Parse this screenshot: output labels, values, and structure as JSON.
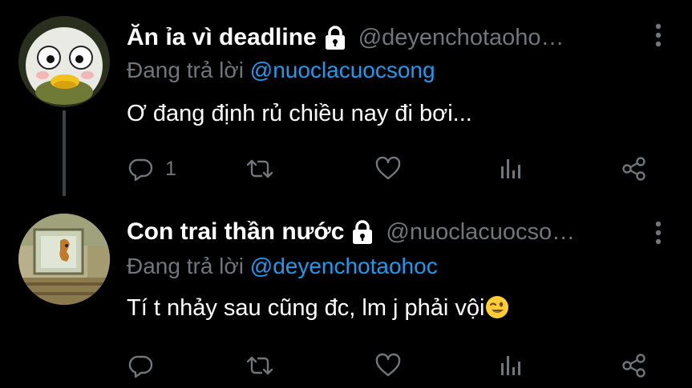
{
  "tweets": [
    {
      "display_name": "Ăn ỉa vì deadline",
      "handle": "@deyenchotaoho…",
      "reply_prefix": "Đang trả lời",
      "reply_to": "@nuoclacuocsong",
      "text": "Ơ đang định rủ chiều nay đi bơi...",
      "reply_count": "1",
      "avatar_icon": "duck-avatar",
      "has_emoji": false
    },
    {
      "display_name": "Con trai thần nước",
      "handle": "@nuoclacuocso…",
      "reply_prefix": "Đang trả lời",
      "reply_to": "@deyenchotaohoc",
      "text": "Tí t nhảy sau cũng đc, lm j phải vội",
      "reply_count": "",
      "avatar_icon": "cartoon-avatar",
      "has_emoji": true,
      "emoji": "winking-face"
    }
  ],
  "colors": {
    "background": "#000000",
    "text_primary": "#ffffff",
    "text_secondary": "#71767b",
    "link": "#1d9bf0",
    "thread_line": "#3d4449"
  }
}
